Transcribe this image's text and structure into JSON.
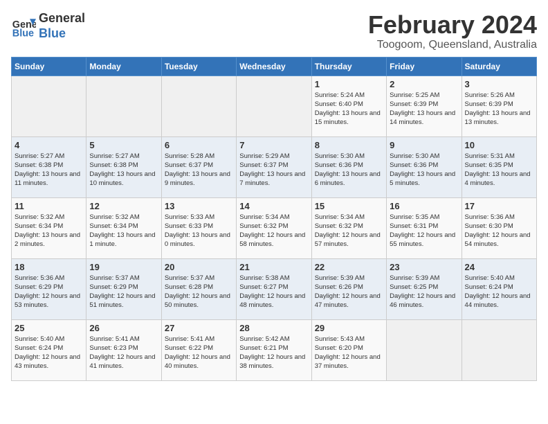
{
  "header": {
    "logo_line1": "General",
    "logo_line2": "Blue",
    "month": "February 2024",
    "location": "Toogoom, Queensland, Australia"
  },
  "days_of_week": [
    "Sunday",
    "Monday",
    "Tuesday",
    "Wednesday",
    "Thursday",
    "Friday",
    "Saturday"
  ],
  "weeks": [
    [
      {
        "day": "",
        "info": ""
      },
      {
        "day": "",
        "info": ""
      },
      {
        "day": "",
        "info": ""
      },
      {
        "day": "",
        "info": ""
      },
      {
        "day": "1",
        "info": "Sunrise: 5:24 AM\nSunset: 6:40 PM\nDaylight: 13 hours\nand 15 minutes."
      },
      {
        "day": "2",
        "info": "Sunrise: 5:25 AM\nSunset: 6:39 PM\nDaylight: 13 hours\nand 14 minutes."
      },
      {
        "day": "3",
        "info": "Sunrise: 5:26 AM\nSunset: 6:39 PM\nDaylight: 13 hours\nand 13 minutes."
      }
    ],
    [
      {
        "day": "4",
        "info": "Sunrise: 5:27 AM\nSunset: 6:38 PM\nDaylight: 13 hours\nand 11 minutes."
      },
      {
        "day": "5",
        "info": "Sunrise: 5:27 AM\nSunset: 6:38 PM\nDaylight: 13 hours\nand 10 minutes."
      },
      {
        "day": "6",
        "info": "Sunrise: 5:28 AM\nSunset: 6:37 PM\nDaylight: 13 hours\nand 9 minutes."
      },
      {
        "day": "7",
        "info": "Sunrise: 5:29 AM\nSunset: 6:37 PM\nDaylight: 13 hours\nand 7 minutes."
      },
      {
        "day": "8",
        "info": "Sunrise: 5:30 AM\nSunset: 6:36 PM\nDaylight: 13 hours\nand 6 minutes."
      },
      {
        "day": "9",
        "info": "Sunrise: 5:30 AM\nSunset: 6:36 PM\nDaylight: 13 hours\nand 5 minutes."
      },
      {
        "day": "10",
        "info": "Sunrise: 5:31 AM\nSunset: 6:35 PM\nDaylight: 13 hours\nand 4 minutes."
      }
    ],
    [
      {
        "day": "11",
        "info": "Sunrise: 5:32 AM\nSunset: 6:34 PM\nDaylight: 13 hours\nand 2 minutes."
      },
      {
        "day": "12",
        "info": "Sunrise: 5:32 AM\nSunset: 6:34 PM\nDaylight: 13 hours\nand 1 minute."
      },
      {
        "day": "13",
        "info": "Sunrise: 5:33 AM\nSunset: 6:33 PM\nDaylight: 13 hours\nand 0 minutes."
      },
      {
        "day": "14",
        "info": "Sunrise: 5:34 AM\nSunset: 6:32 PM\nDaylight: 12 hours\nand 58 minutes."
      },
      {
        "day": "15",
        "info": "Sunrise: 5:34 AM\nSunset: 6:32 PM\nDaylight: 12 hours\nand 57 minutes."
      },
      {
        "day": "16",
        "info": "Sunrise: 5:35 AM\nSunset: 6:31 PM\nDaylight: 12 hours\nand 55 minutes."
      },
      {
        "day": "17",
        "info": "Sunrise: 5:36 AM\nSunset: 6:30 PM\nDaylight: 12 hours\nand 54 minutes."
      }
    ],
    [
      {
        "day": "18",
        "info": "Sunrise: 5:36 AM\nSunset: 6:29 PM\nDaylight: 12 hours\nand 53 minutes."
      },
      {
        "day": "19",
        "info": "Sunrise: 5:37 AM\nSunset: 6:29 PM\nDaylight: 12 hours\nand 51 minutes."
      },
      {
        "day": "20",
        "info": "Sunrise: 5:37 AM\nSunset: 6:28 PM\nDaylight: 12 hours\nand 50 minutes."
      },
      {
        "day": "21",
        "info": "Sunrise: 5:38 AM\nSunset: 6:27 PM\nDaylight: 12 hours\nand 48 minutes."
      },
      {
        "day": "22",
        "info": "Sunrise: 5:39 AM\nSunset: 6:26 PM\nDaylight: 12 hours\nand 47 minutes."
      },
      {
        "day": "23",
        "info": "Sunrise: 5:39 AM\nSunset: 6:25 PM\nDaylight: 12 hours\nand 46 minutes."
      },
      {
        "day": "24",
        "info": "Sunrise: 5:40 AM\nSunset: 6:24 PM\nDaylight: 12 hours\nand 44 minutes."
      }
    ],
    [
      {
        "day": "25",
        "info": "Sunrise: 5:40 AM\nSunset: 6:24 PM\nDaylight: 12 hours\nand 43 minutes."
      },
      {
        "day": "26",
        "info": "Sunrise: 5:41 AM\nSunset: 6:23 PM\nDaylight: 12 hours\nand 41 minutes."
      },
      {
        "day": "27",
        "info": "Sunrise: 5:41 AM\nSunset: 6:22 PM\nDaylight: 12 hours\nand 40 minutes."
      },
      {
        "day": "28",
        "info": "Sunrise: 5:42 AM\nSunset: 6:21 PM\nDaylight: 12 hours\nand 38 minutes."
      },
      {
        "day": "29",
        "info": "Sunrise: 5:43 AM\nSunset: 6:20 PM\nDaylight: 12 hours\nand 37 minutes."
      },
      {
        "day": "",
        "info": ""
      },
      {
        "day": "",
        "info": ""
      }
    ]
  ]
}
